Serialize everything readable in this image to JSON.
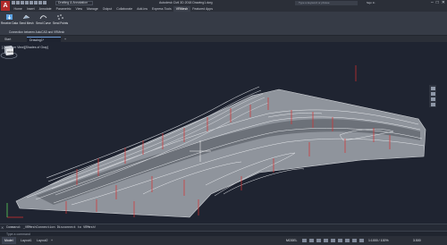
{
  "app": {
    "logo": "A",
    "window_title": "Autodesk Civil 3D 2018   Drawing1.dwg",
    "workspace": "Drafting & Annotation",
    "search_placeholder": "Type a keyword or phrase",
    "user": "Sign In",
    "window_controls": [
      "–",
      "□",
      "✕"
    ]
  },
  "menu_tabs": [
    "Home",
    "Insert",
    "Annotate",
    "Parametric",
    "View",
    "Manage",
    "Output",
    "Collaborate",
    "Add-ins",
    "Express Tools",
    "VRMesh",
    "Featured Apps"
  ],
  "active_menu_tab": "VRMesh",
  "ribbon": {
    "buttons": [
      {
        "label": "Receive Data",
        "icon": "receive-data-icon"
      },
      {
        "label": "Send Mesh",
        "icon": "send-mesh-icon"
      },
      {
        "label": "Send Curve",
        "icon": "send-curve-icon"
      },
      {
        "label": "Send Points",
        "icon": "send-points-icon"
      }
    ],
    "panel_title": "Connection between AutoCAD and VRMesh"
  },
  "file_tabs": {
    "start": "Start",
    "drawing": "Drawing1*",
    "add": "+"
  },
  "viewport": {
    "label": "[-][Custom View][Shades of Gray]",
    "viewcube_face": "FRONT"
  },
  "command": {
    "history": "Command: _VRMeshConnection Disconnect to VRMesh!",
    "prompt": "Type a command"
  },
  "status": {
    "layouts": [
      "Model",
      "Layout1",
      "Layout2"
    ],
    "add_layout": "+",
    "space": "MODEL",
    "scale": "1:1000 / 100%",
    "units": "3.500"
  },
  "colors": {
    "accent": "#6b9ad6",
    "logo_red": "#b12a2a",
    "background": "#1f2431",
    "marker_red": "#d93030"
  }
}
